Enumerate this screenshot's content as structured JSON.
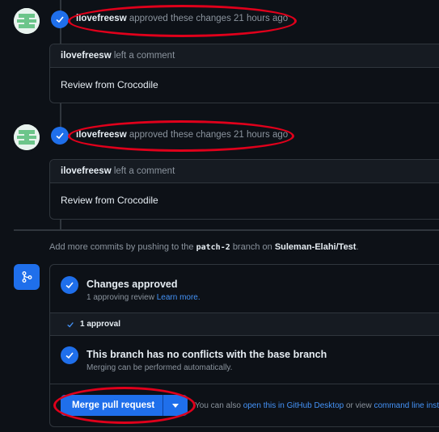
{
  "timeline": [
    {
      "user": "ilovefreesw",
      "action": "approved these changes",
      "time": "21 hours ago",
      "comment_header_user": "ilovefreesw",
      "comment_header_action": "left a comment",
      "comment_body": "Review from Crocodile"
    },
    {
      "user": "ilovefreesw",
      "action": "approved these changes",
      "time": "21 hours ago",
      "comment_header_user": "ilovefreesw",
      "comment_header_action": "left a comment",
      "comment_body": "Review from Crocodile"
    }
  ],
  "commit_hint": {
    "prefix": "Add more commits by pushing to the",
    "branch": "patch-2",
    "middle": "branch on",
    "repo": "Suleman-Elahi/Test",
    "suffix": "."
  },
  "merge": {
    "approved_title": "Changes approved",
    "approved_sub": "1 approving review",
    "learn_more": "Learn more.",
    "approval_count": "1 approval",
    "conflict_title": "This branch has no conflicts with the base branch",
    "conflict_sub": "Merging can be performed automatically.",
    "merge_button": "Merge pull request",
    "also_prefix": "You can also",
    "desktop_link": "open this in GitHub Desktop",
    "or_view": "or view",
    "cli_link": "command line instruct"
  },
  "colors": {
    "accent": "#1f6feb",
    "link": "#4493f8",
    "annotation": "#e0001b",
    "background": "#0d1117"
  },
  "icons": [
    "avatar-identicon",
    "check-icon",
    "git-merge-icon",
    "dropdown-caret-icon"
  ]
}
